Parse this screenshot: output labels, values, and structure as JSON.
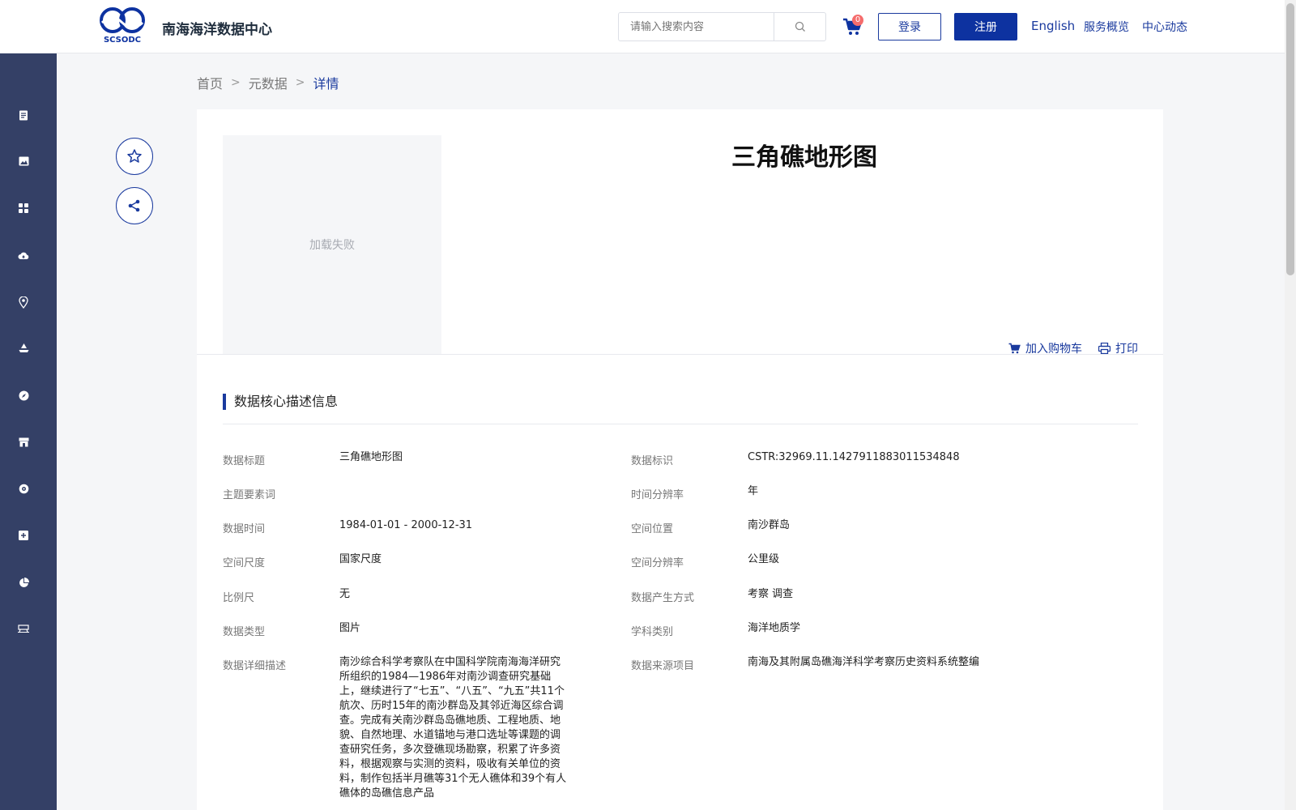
{
  "header": {
    "site_title": "南海海洋数据中心",
    "logo_text": "SCSODC",
    "search_placeholder": "请输入搜索内容",
    "cart_count": "0",
    "login_label": "登录",
    "register_label": "注册",
    "english_label": "English",
    "service_label": "服务概览",
    "news_label": "中心动态"
  },
  "breadcrumb": {
    "home": "首页",
    "metadata": "元数据",
    "current": "详情"
  },
  "detail": {
    "image_status": "加载失败",
    "title": "三角礁地形图",
    "add_to_cart": "加入购物车",
    "print": "打印",
    "section_title": "数据核心描述信息"
  },
  "fields_left": [
    {
      "label": "数据标题",
      "value": "三角礁地形图"
    },
    {
      "label": "主题要素词",
      "value": ""
    },
    {
      "label": "数据时间",
      "value": "1984-01-01 - 2000-12-31"
    },
    {
      "label": "空间尺度",
      "value": "国家尺度"
    },
    {
      "label": "比例尺",
      "value": "无"
    },
    {
      "label": "数据类型",
      "value": "图片"
    },
    {
      "label": "数据详细描述",
      "value": "南沙综合科学考察队在中国科学院南海海洋研究所组织的1984—1986年对南沙调查研究基础上，继续进行了“七五”、“八五”、“九五”共11个航次、历时15年的南沙群岛及其邻近海区综合调查。完成有关南沙群岛岛礁地质、工程地质、地貌、自然地理、水道锚地与港口选址等课题的调查研究任务，多次登礁现场勘察，积累了许多资料，根据观察与实测的资料，吸收有关单位的资料，制作包括半月礁等31个无人礁体和39个有人礁体的岛礁信息产品"
    }
  ],
  "fields_right": [
    {
      "label": "数据标识",
      "value": "CSTR:32969.11.1427911883011534848"
    },
    {
      "label": "时间分辨率",
      "value": "年"
    },
    {
      "label": "空间位置",
      "value": "南沙群岛"
    },
    {
      "label": "空间分辨率",
      "value": "公里级"
    },
    {
      "label": "数据产生方式",
      "value": "考察 调查"
    },
    {
      "label": "学科类别",
      "value": "海洋地质学"
    },
    {
      "label": "数据来源项目",
      "value": "南海及其附属岛礁海洋科学考察历史资料系统整编"
    }
  ],
  "sidebar_icons": [
    "document-icon",
    "image-icon",
    "grid-icon",
    "cloud-upload-icon",
    "location-icon",
    "ship-icon",
    "compass-icon",
    "store-icon",
    "globe-icon",
    "plus-square-icon",
    "pie-chart-icon",
    "station-icon"
  ],
  "colors": {
    "primary": "#0d32a0",
    "sidebar": "#344066",
    "accent_text": "#1a3a9e"
  }
}
